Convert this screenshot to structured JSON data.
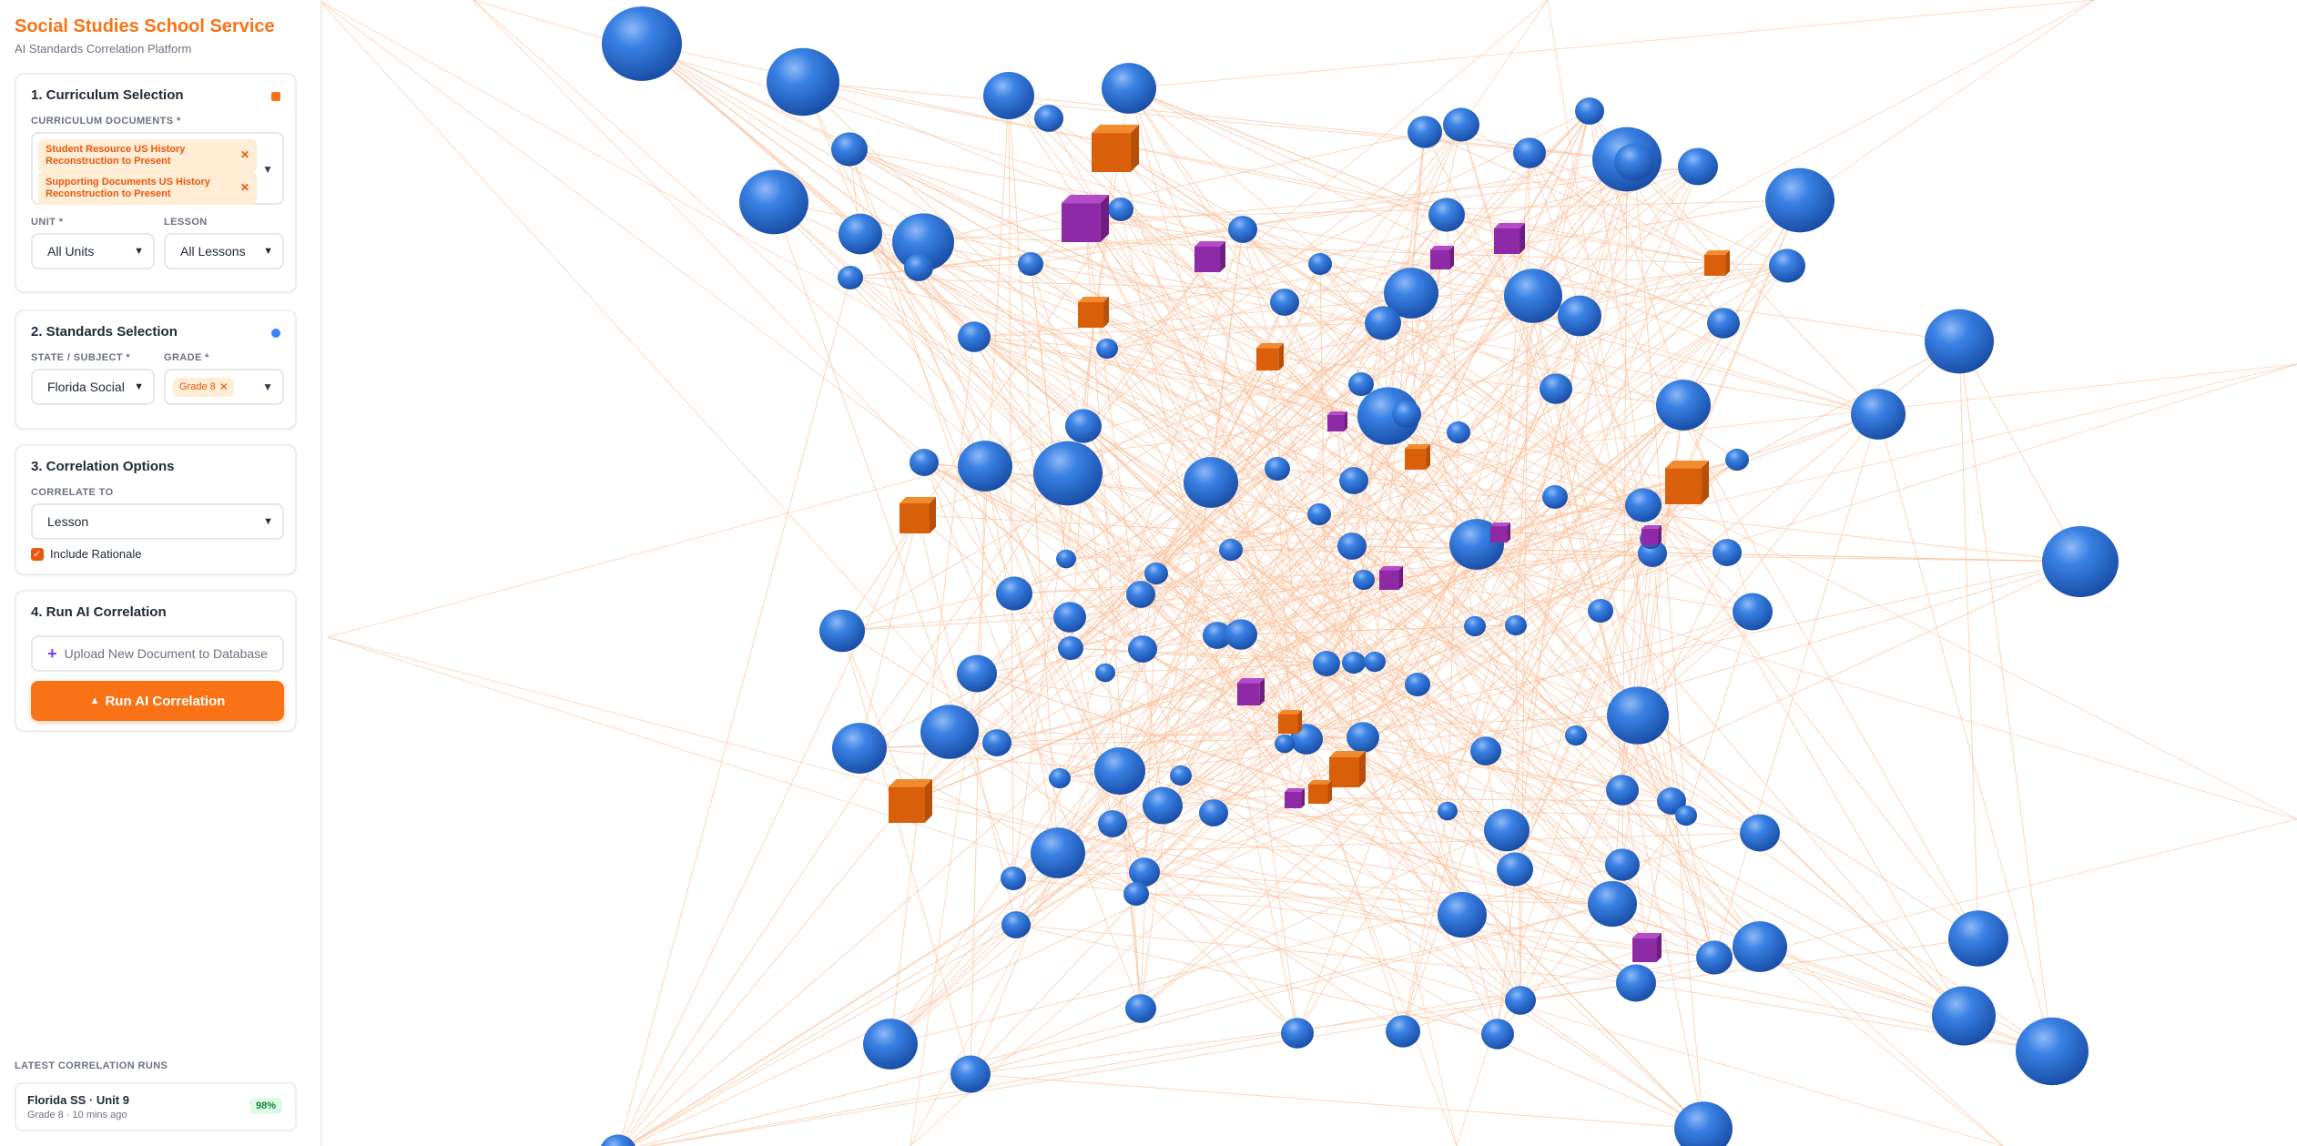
{
  "brand": {
    "title": "Social Studies School Service",
    "subtitle": "AI Standards Correlation Platform"
  },
  "sections": {
    "curriculum": {
      "title": "1. Curriculum Selection",
      "documents_label": "CURRICULUM DOCUMENTS *",
      "documents": [
        "Student Resource US History Reconstruction to Present",
        "Supporting Documents US History Reconstruction to Present"
      ],
      "unit_label": "UNIT *",
      "unit_value": "All Units",
      "lesson_label": "LESSON",
      "lesson_value": "All Lessons"
    },
    "standards": {
      "title": "2. Standards Selection",
      "state_label": "STATE / SUBJECT *",
      "state_value": "Florida Social",
      "grade_label": "GRADE *",
      "grade_tags": [
        "Grade 8"
      ]
    },
    "options": {
      "title": "3. Correlation Options",
      "correlate_label": "CORRELATE TO",
      "correlate_value": "Lesson",
      "include_rationale_label": "Include Rationale",
      "include_rationale_checked": true
    },
    "run": {
      "title": "4. Run AI Correlation",
      "upload_label": "Upload New Document to Database",
      "run_label": "Run AI Correlation"
    }
  },
  "latest_runs": {
    "label": "LATEST CORRELATION RUNS",
    "items": [
      {
        "title": "Florida SS · Unit 9",
        "meta": "Grade 8 · 10 mins ago",
        "score": "98%"
      }
    ]
  },
  "colors": {
    "accent": "#f97316",
    "node_blue": "#2f74d8",
    "node_orange": "#ea6a10",
    "node_purple": "#9b2fb3",
    "edge": "#fbc7a8"
  },
  "icons": {
    "remove_tag": "close-icon",
    "dropdown": "chevron-down-icon",
    "upload": "plus-icon",
    "run": "sparkle-icon"
  }
}
